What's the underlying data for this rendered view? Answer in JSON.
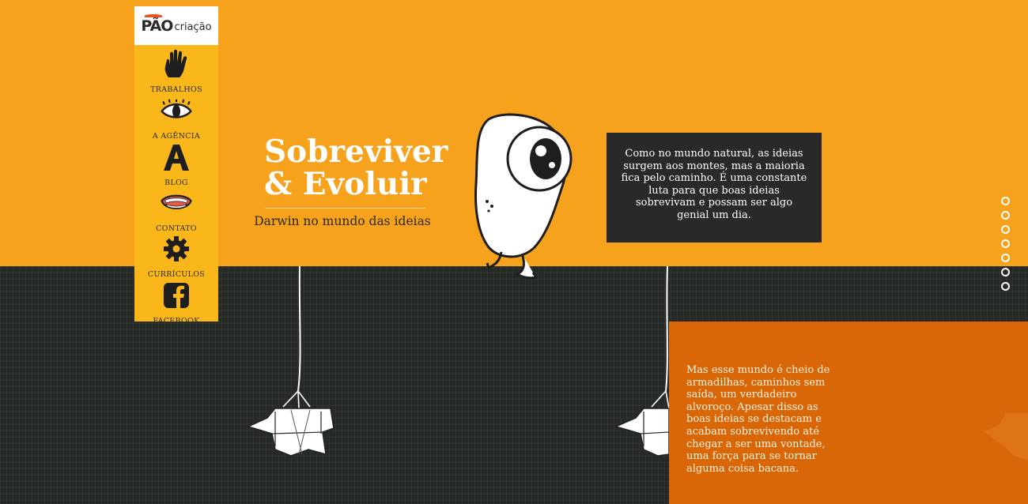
{
  "brand": {
    "logo_bold": "PÃO",
    "logo_light": "criação"
  },
  "nav": [
    {
      "label": "TRABALHOS",
      "icon": "hand-icon"
    },
    {
      "label": "A AGÊNCIA",
      "icon": "eye-icon"
    },
    {
      "label": "BLOG",
      "icon": "letter-a-icon"
    },
    {
      "label": "CONTATO",
      "icon": "mouth-icon"
    },
    {
      "label": "CURRÍCULOS",
      "icon": "gear-icon"
    },
    {
      "label": "FACEBOOK",
      "icon": "facebook-icon"
    }
  ],
  "hero": {
    "title_line1": "Sobreviver",
    "title_line2": "& Evoluir",
    "subtitle": "Darwin no mundo das ideias"
  },
  "intro_text": "Como no mundo natural, as ideias surgem aos montes, mas a maioria fica pelo caminho. É uma constante luta para que boas ideias sobrevivam e possam ser algo genial um dia.",
  "trap_text": "Mas esse mundo é cheio de armadilhas, caminhos sem saída, um verdadeiro alvoroço. Apesar disso as boas ideias se destacam e acabam sobrevivendo até chegar a ser uma vontade, uma força para se tornar alguma coisa bacana.",
  "pagination": {
    "count": 7,
    "active_index": 0
  },
  "colors": {
    "top": "#f6a21c",
    "sidebar": "#f9b71a",
    "dark": "#262a27",
    "accent": "#d96707"
  }
}
